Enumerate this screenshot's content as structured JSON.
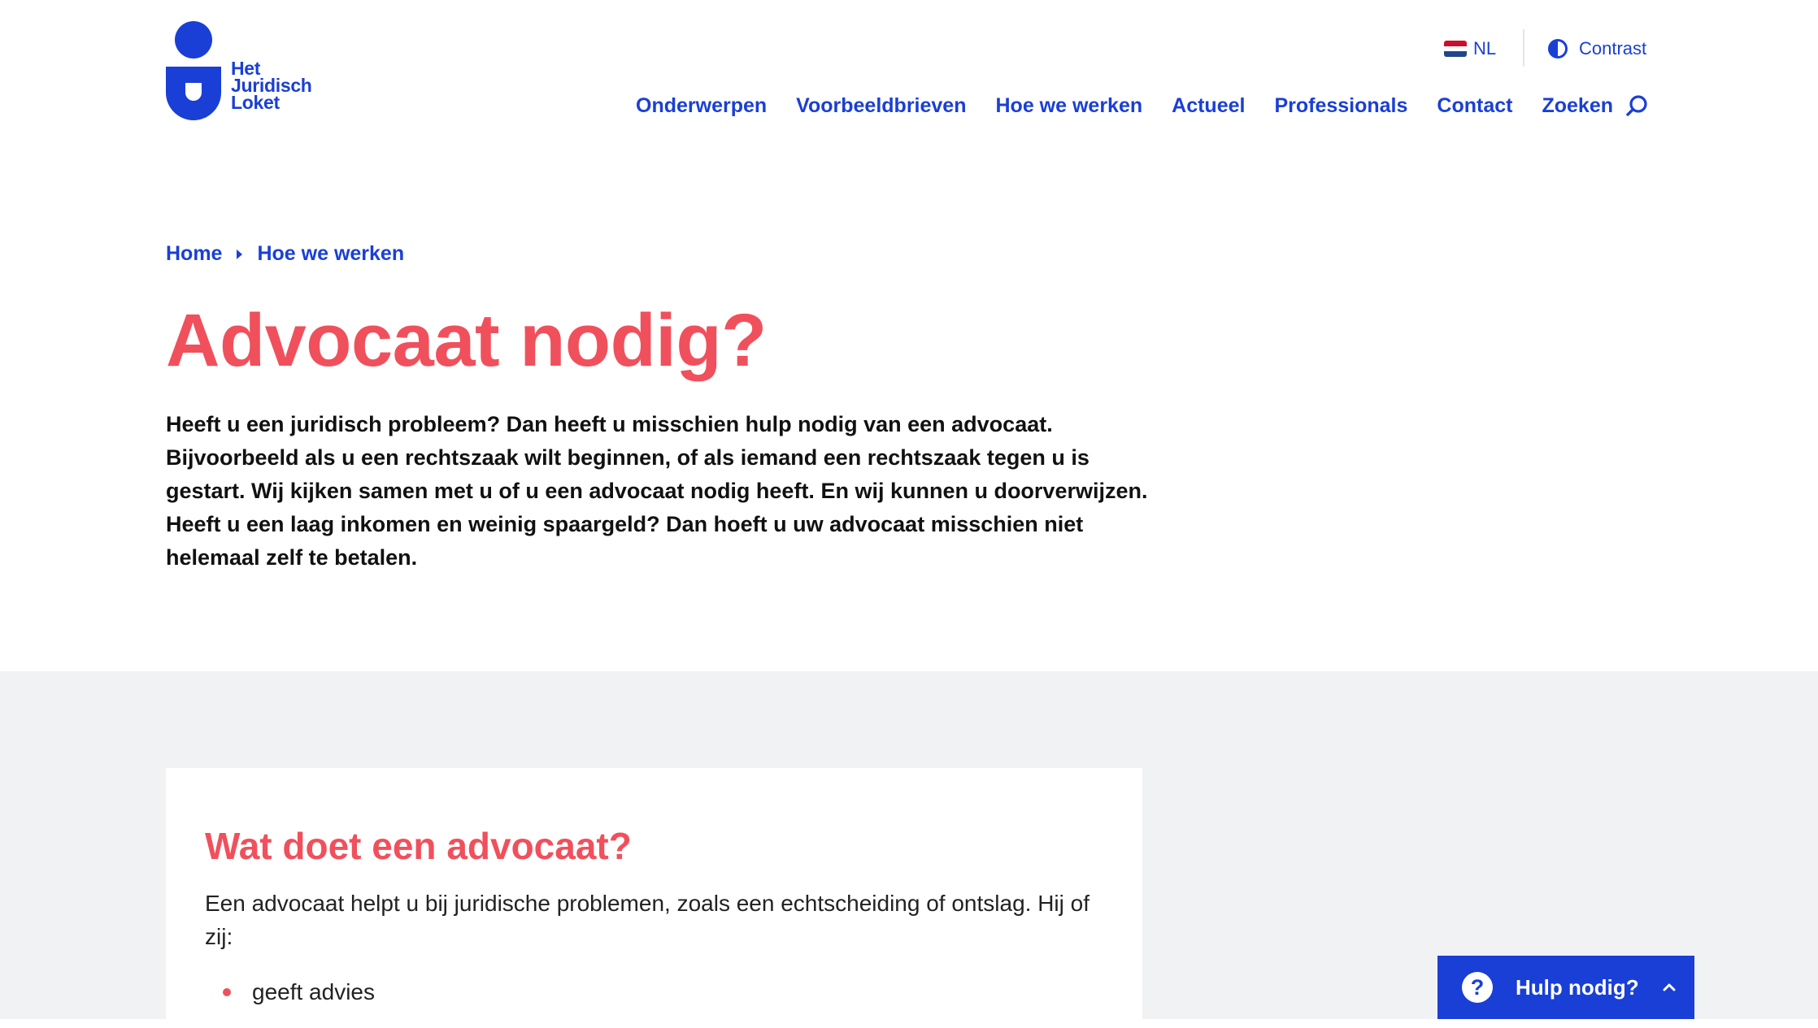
{
  "header": {
    "logo_lines": [
      "Het",
      "Juridisch",
      "Loket"
    ],
    "language": "NL",
    "contrast_label": "Contrast",
    "nav": [
      "Onderwerpen",
      "Voorbeeldbrieven",
      "Hoe we werken",
      "Actueel",
      "Professionals",
      "Contact",
      "Zoeken"
    ]
  },
  "breadcrumb": [
    "Home",
    "Hoe we werken"
  ],
  "page": {
    "title": "Advocaat nodig?",
    "intro": "Heeft u een juridisch probleem? Dan heeft u misschien hulp nodig van een advocaat. Bijvoorbeeld als u een rechtszaak wilt beginnen, of als iemand een rechtszaak tegen u is gestart. Wij kijken samen met u of u een advocaat nodig heeft. En wij kunnen u doorverwijzen. Heeft u een laag inkomen en weinig spaargeld? Dan hoeft u uw advocaat misschien niet helemaal zelf te betalen."
  },
  "card": {
    "title": "Wat doet een advocaat?",
    "text": "Een advocaat helpt u bij juridische problemen, zoals een echtscheiding of ontslag. Hij of zij:",
    "list": [
      "geeft advies"
    ]
  },
  "help_widget": {
    "label": "Hulp nodig?",
    "icon_glyph": "?"
  },
  "colors": {
    "brand_blue": "#1a3fd6",
    "accent_red": "#f0505c",
    "section_grey": "#f1f2f4"
  },
  "icons": [
    "logo-j-icon",
    "nl-flag-icon",
    "contrast-icon",
    "search-icon",
    "chevron-right-icon",
    "question-icon",
    "chevron-up-icon"
  ]
}
